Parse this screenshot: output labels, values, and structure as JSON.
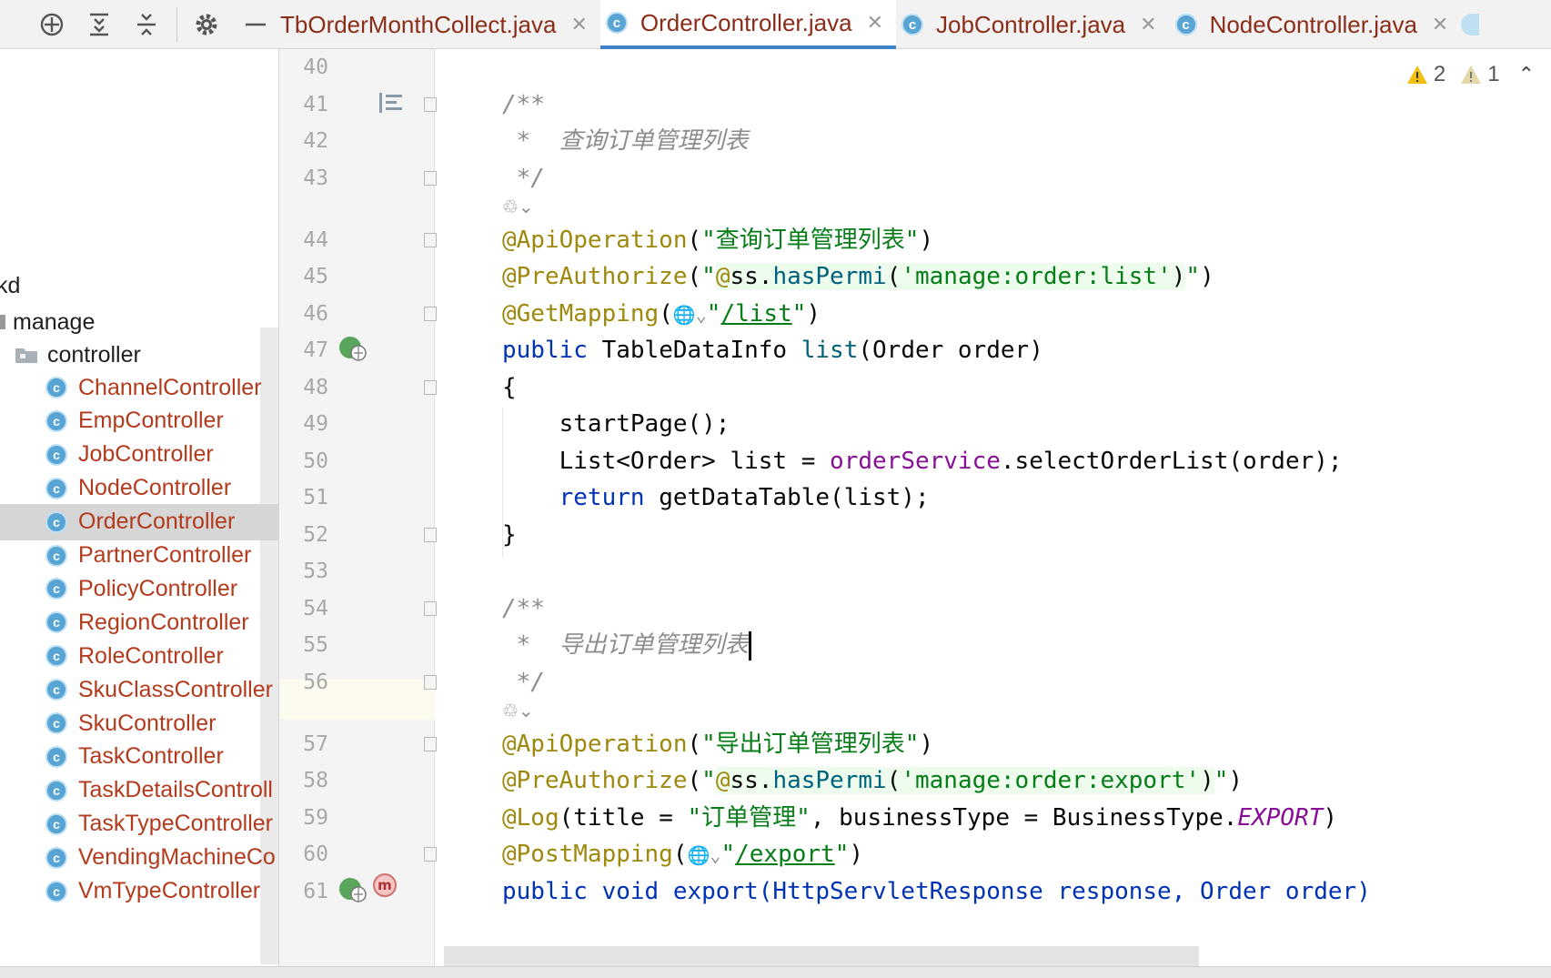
{
  "toolbar": {
    "icons": [
      "crosshair-icon",
      "expand-all-icon",
      "collapse-all-icon",
      "gear-icon",
      "minimize-icon"
    ]
  },
  "tabs": [
    {
      "label": "TbOrderMonthCollect.java",
      "active": false
    },
    {
      "label": "OrderController.java",
      "active": true
    },
    {
      "label": "JobController.java",
      "active": false
    },
    {
      "label": "NodeController.java",
      "active": false
    }
  ],
  "tree": {
    "root_partial": "kd",
    "package": "manage",
    "folder": "controller",
    "class_icon_letter": "c",
    "classes": [
      "ChannelController",
      "EmpController",
      "JobController",
      "NodeController",
      "OrderController",
      "PartnerController",
      "PolicyController",
      "RegionController",
      "RoleController",
      "SkuClassController",
      "SkuController",
      "TaskController",
      "TaskDetailsControll",
      "TaskTypeController",
      "VendingMachineCo",
      "VmTypeController"
    ],
    "selected": "OrderController"
  },
  "inspections": {
    "warnings": "2",
    "weak_warnings": "1"
  },
  "editor": {
    "line_numbers": [
      "40",
      "41",
      "42",
      "43",
      "44",
      "45",
      "46",
      "47",
      "48",
      "49",
      "50",
      "51",
      "52",
      "53",
      "54",
      "55",
      "56",
      "57",
      "58",
      "59",
      "60",
      "61"
    ],
    "doc1_open": "/**",
    "doc1_body": " *  查询订单管理列表",
    "doc1_close": " */",
    "l44_ann": "@ApiOperation",
    "l44_str": "\"查询订单管理列表\"",
    "l45_ann": "@PreAuthorize",
    "l45_q1": "\"",
    "l45_at": "@",
    "l45_ss": "ss.",
    "l45_method": "hasPermi",
    "l45_arg": "'manage:order:list'",
    "l45_q2": "\"",
    "l46_ann": "@GetMapping",
    "l46_path": "/list",
    "l47_kw": "public",
    "l47_rest": " TableDataInfo ",
    "l47_name": "list",
    "l47_params": "(Order order)",
    "l48": "{",
    "l49": "startPage();",
    "l50_a": "List<Order> list = ",
    "l50_field": "orderService",
    "l50_b": ".selectOrderList(order);",
    "l51_kw": "return",
    "l51_rest": " getDataTable(list);",
    "l52": "}",
    "doc2_open": "/**",
    "doc2_body": " *  导出订单管理列表",
    "doc2_close": " */",
    "l57_ann": "@ApiOperation",
    "l57_str": "\"导出订单管理列表\"",
    "l58_ann": "@PreAuthorize",
    "l58_arg": "'manage:order:export'",
    "l59_ann": "@Log",
    "l59_a": "(title = ",
    "l59_str": "\"订单管理\"",
    "l59_b": ", businessType = BusinessType.",
    "l59_const": "EXPORT",
    "l59_c": ")",
    "l60_ann": "@PostMapping",
    "l60_path": "/export",
    "l61": "public void export(HttpServletResponse response, Order order)"
  }
}
